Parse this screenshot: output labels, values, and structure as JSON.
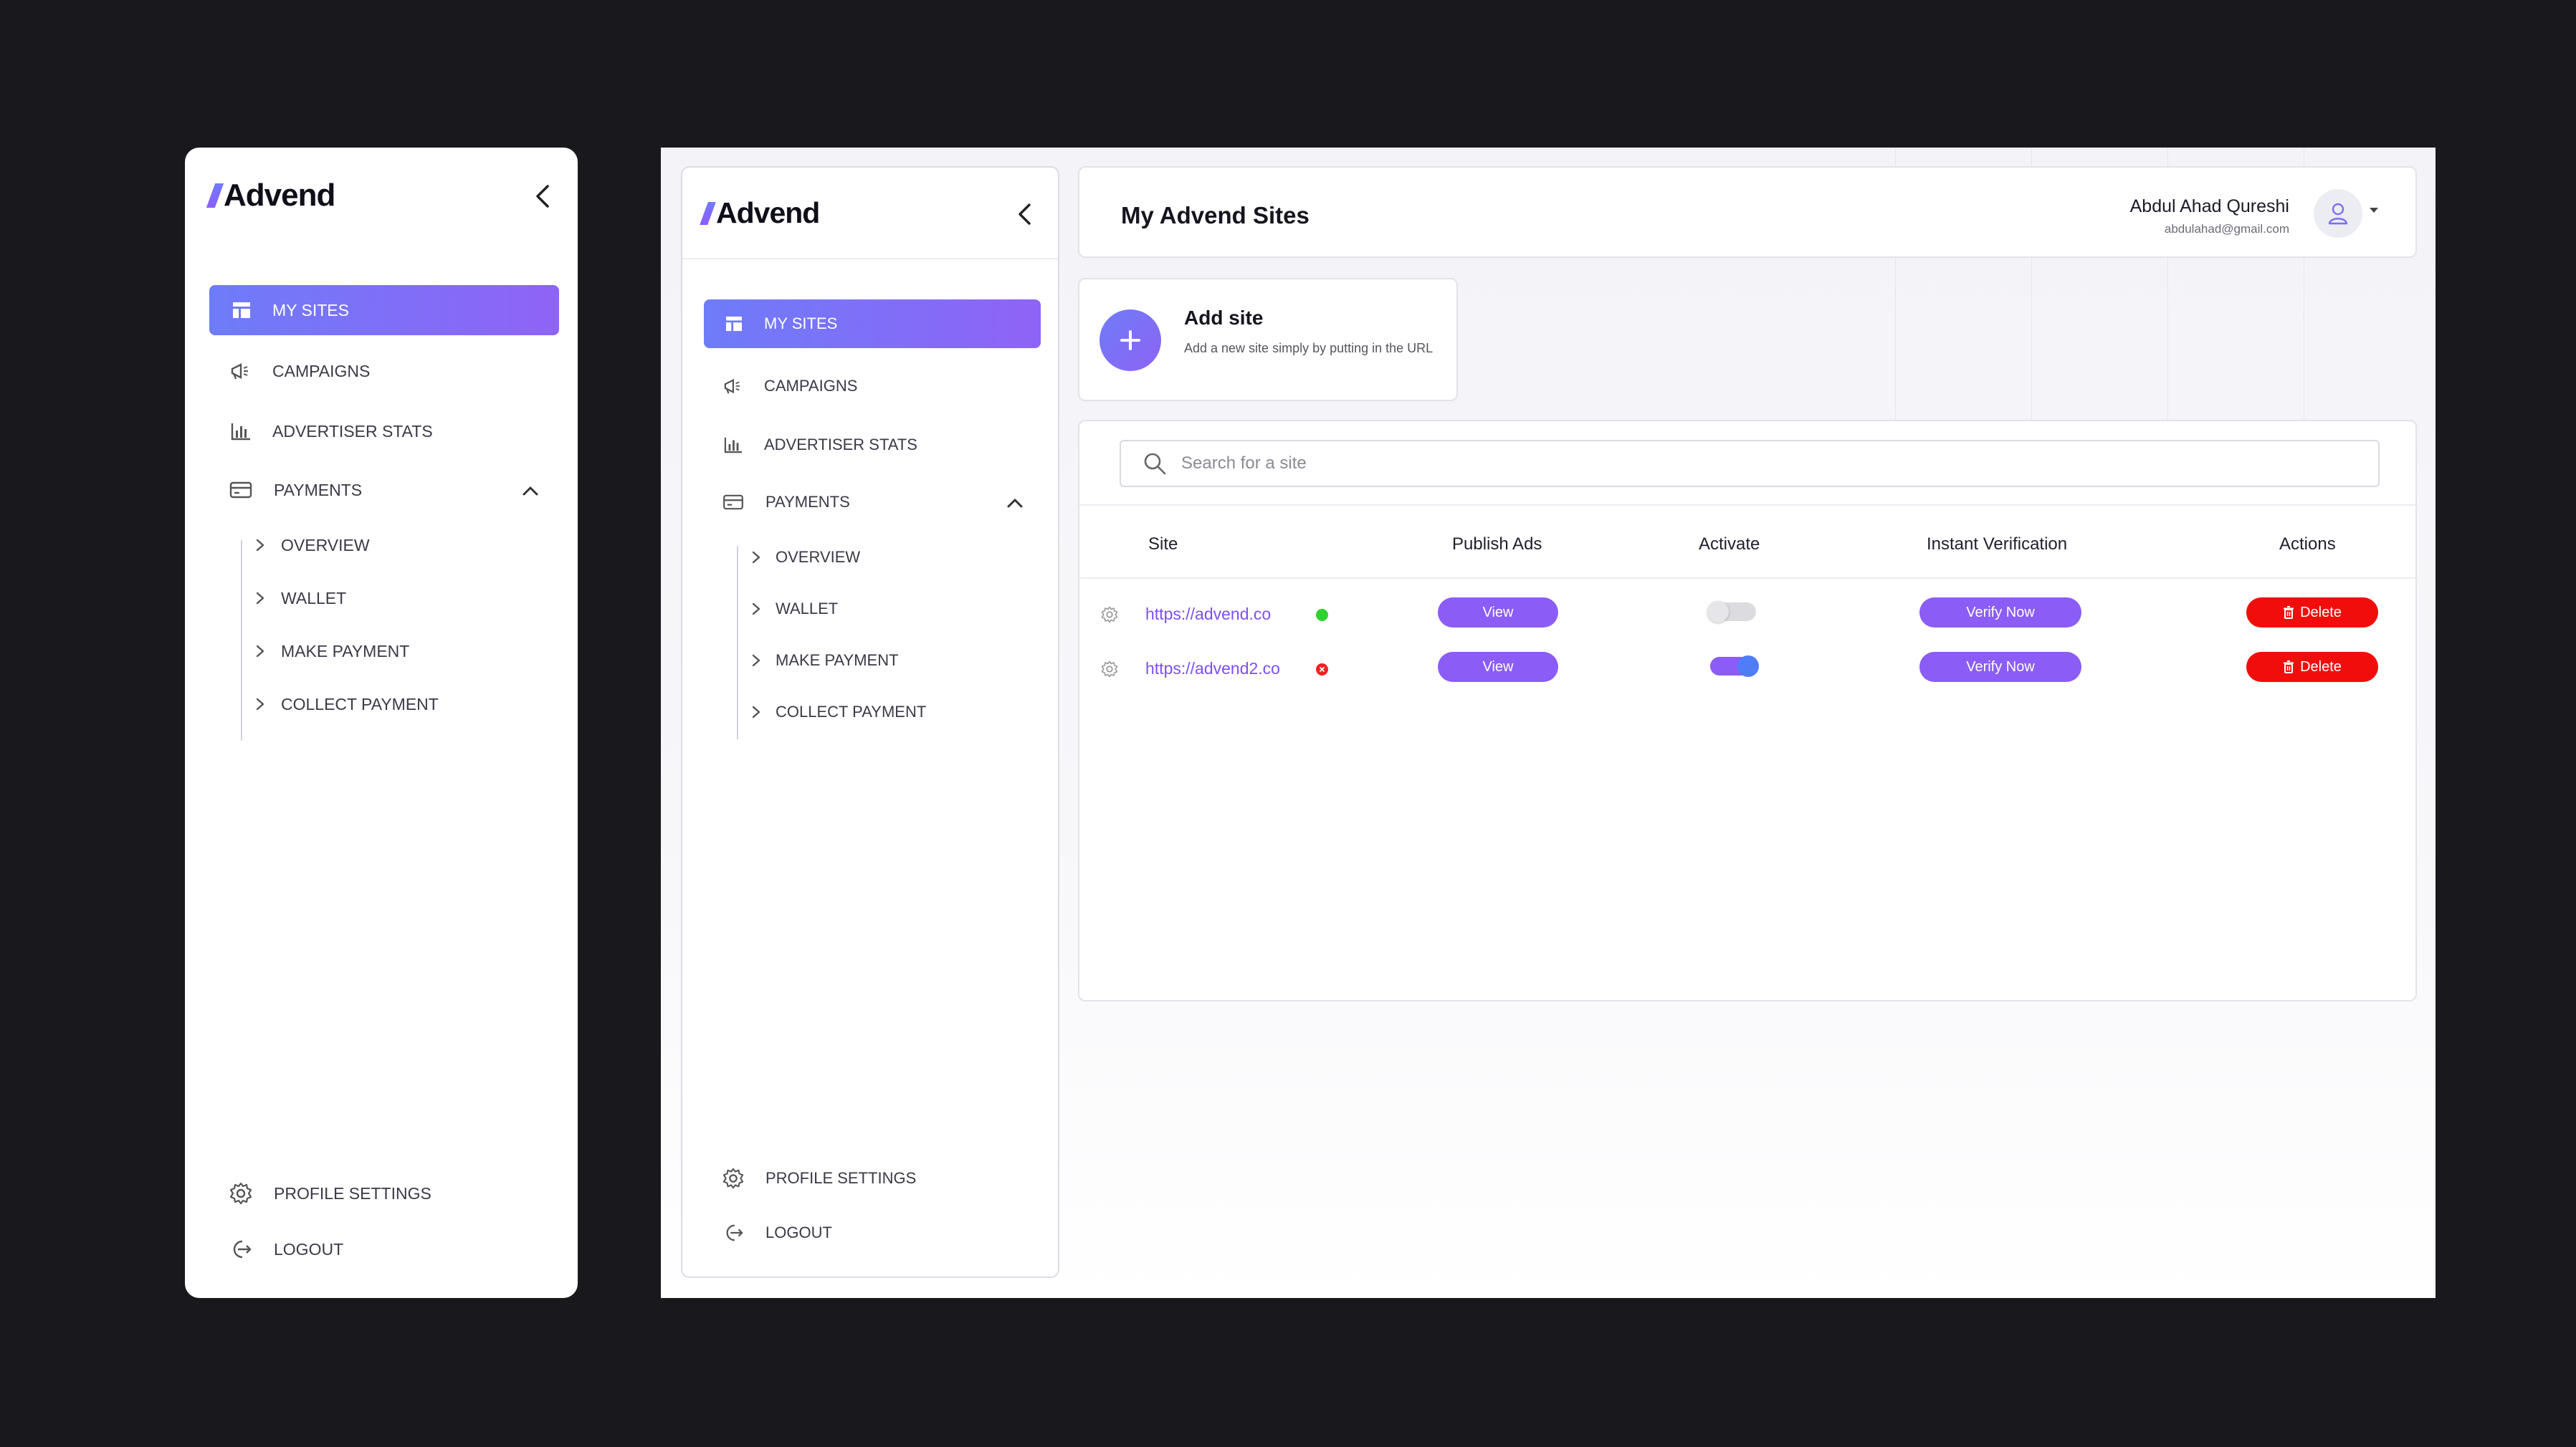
{
  "brand": {
    "name": "Advend",
    "accent": "#7b6ff7",
    "accent_start": "#6e7cf8",
    "accent_end": "#8f63f7"
  },
  "sidebar": {
    "items": [
      {
        "label": "MY SITES",
        "icon": "layout-icon",
        "active": true
      },
      {
        "label": "CAMPAIGNS",
        "icon": "megaphone-icon"
      },
      {
        "label": "ADVERTISER STATS",
        "icon": "bar-chart-icon"
      },
      {
        "label": "PAYMENTS",
        "icon": "credit-card-icon",
        "expanded": true
      }
    ],
    "sub_items": [
      {
        "label": "OVERVIEW"
      },
      {
        "label": "WALLET"
      },
      {
        "label": "MAKE PAYMENT"
      },
      {
        "label": "COLLECT PAYMENT"
      }
    ],
    "bottom_items": [
      {
        "label": "PROFILE SETTINGS",
        "icon": "gear-icon"
      },
      {
        "label": "LOGOUT",
        "icon": "logout-icon"
      }
    ]
  },
  "header": {
    "title": "My Advend Sites",
    "user_name": "Abdul Ahad Qureshi",
    "user_email": "abdulahad@gmail.com"
  },
  "add_site": {
    "title": "Add site",
    "description": "Add a new site simply by putting in the URL"
  },
  "search": {
    "placeholder": "Search for a site"
  },
  "table": {
    "columns": [
      "Site",
      "Publish Ads",
      "Activate",
      "Instant Verification",
      "Actions"
    ],
    "rows": [
      {
        "site": "https://advend.co",
        "status_color": "#2fd12f",
        "publish_label": "View",
        "active": false,
        "verify_label": "Verify Now",
        "delete_label": "Delete"
      },
      {
        "site": "https://advend2.co",
        "status_color": "#ee2222",
        "publish_label": "View",
        "active": true,
        "verify_label": "Verify Now",
        "delete_label": "Delete"
      }
    ]
  }
}
